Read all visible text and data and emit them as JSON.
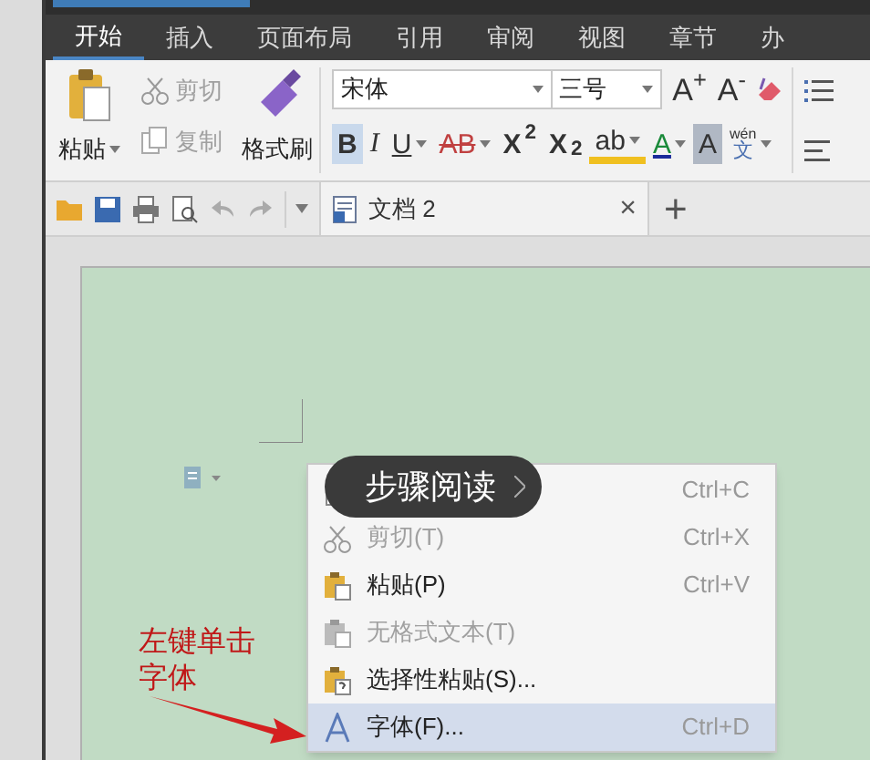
{
  "menu_tabs": [
    {
      "label": "开始",
      "selected": true
    },
    {
      "label": "插入",
      "selected": false
    },
    {
      "label": "页面布局",
      "selected": false
    },
    {
      "label": "引用",
      "selected": false
    },
    {
      "label": "审阅",
      "selected": false
    },
    {
      "label": "视图",
      "selected": false
    },
    {
      "label": "章节",
      "selected": false
    },
    {
      "label": "办",
      "selected": false
    }
  ],
  "clipboard": {
    "paste": "粘贴",
    "cut": {
      "label": "剪切",
      "disabled": true
    },
    "copy": {
      "label": "复制",
      "disabled": true
    },
    "format_painter": "格式刷"
  },
  "font": {
    "name": "宋体",
    "size": "三号",
    "grow": "A$^{+}$",
    "shrink": "A$^{-}$"
  },
  "format_buttons": [
    {
      "kind": "text",
      "label": "B",
      "selected": true,
      "has_menu": false
    },
    {
      "kind": "italic",
      "label": "I",
      "selected": false,
      "has_menu": false
    },
    {
      "kind": "underline",
      "label": "U",
      "selected": false,
      "has_menu": true
    },
    {
      "kind": "strike",
      "label": "AB",
      "selected": false,
      "has_menu": true
    },
    {
      "kind": "text",
      "label": "X$^{2}$",
      "selected": false,
      "has_menu": false
    },
    {
      "kind": "text",
      "label": "X$_{2}$",
      "selected": false,
      "has_menu": false
    },
    {
      "kind": "highlight",
      "label": "ab",
      "selected": false,
      "has_menu": true
    },
    {
      "kind": "color",
      "label": "A",
      "selected": false,
      "has_menu": true
    },
    {
      "kind": "shade",
      "label": "A",
      "selected": false,
      "has_menu": false
    },
    {
      "kind": "phonetic",
      "ruby": "wén",
      "label": "文",
      "selected": false,
      "has_menu": true
    }
  ],
  "doc_tab": {
    "title": "文档 2",
    "close": "×"
  },
  "new_tab": "+",
  "context_menu": [
    {
      "kind": "copy",
      "shortcut": "Ctrl+C",
      "selected": false
    },
    {
      "kind": "cut",
      "label": "剪切(T)",
      "shortcut": "Ctrl+X",
      "disabled": true,
      "selected": false
    },
    {
      "kind": "paste",
      "label": "粘贴(P)",
      "shortcut": "Ctrl+V",
      "disabled": false,
      "selected": false
    },
    {
      "kind": "paste-plain",
      "label": "无格式文本(T)",
      "disabled": true,
      "selected": false
    },
    {
      "kind": "paste-special",
      "label": "选择性粘贴(S)...",
      "disabled": false,
      "selected": false
    },
    {
      "kind": "font",
      "label": "字体(F)...",
      "shortcut": "Ctrl+D",
      "disabled": false,
      "selected": true
    }
  ],
  "step_reading": {
    "label": "步骤阅读"
  },
  "annotation": {
    "text": "左键单击字体"
  }
}
